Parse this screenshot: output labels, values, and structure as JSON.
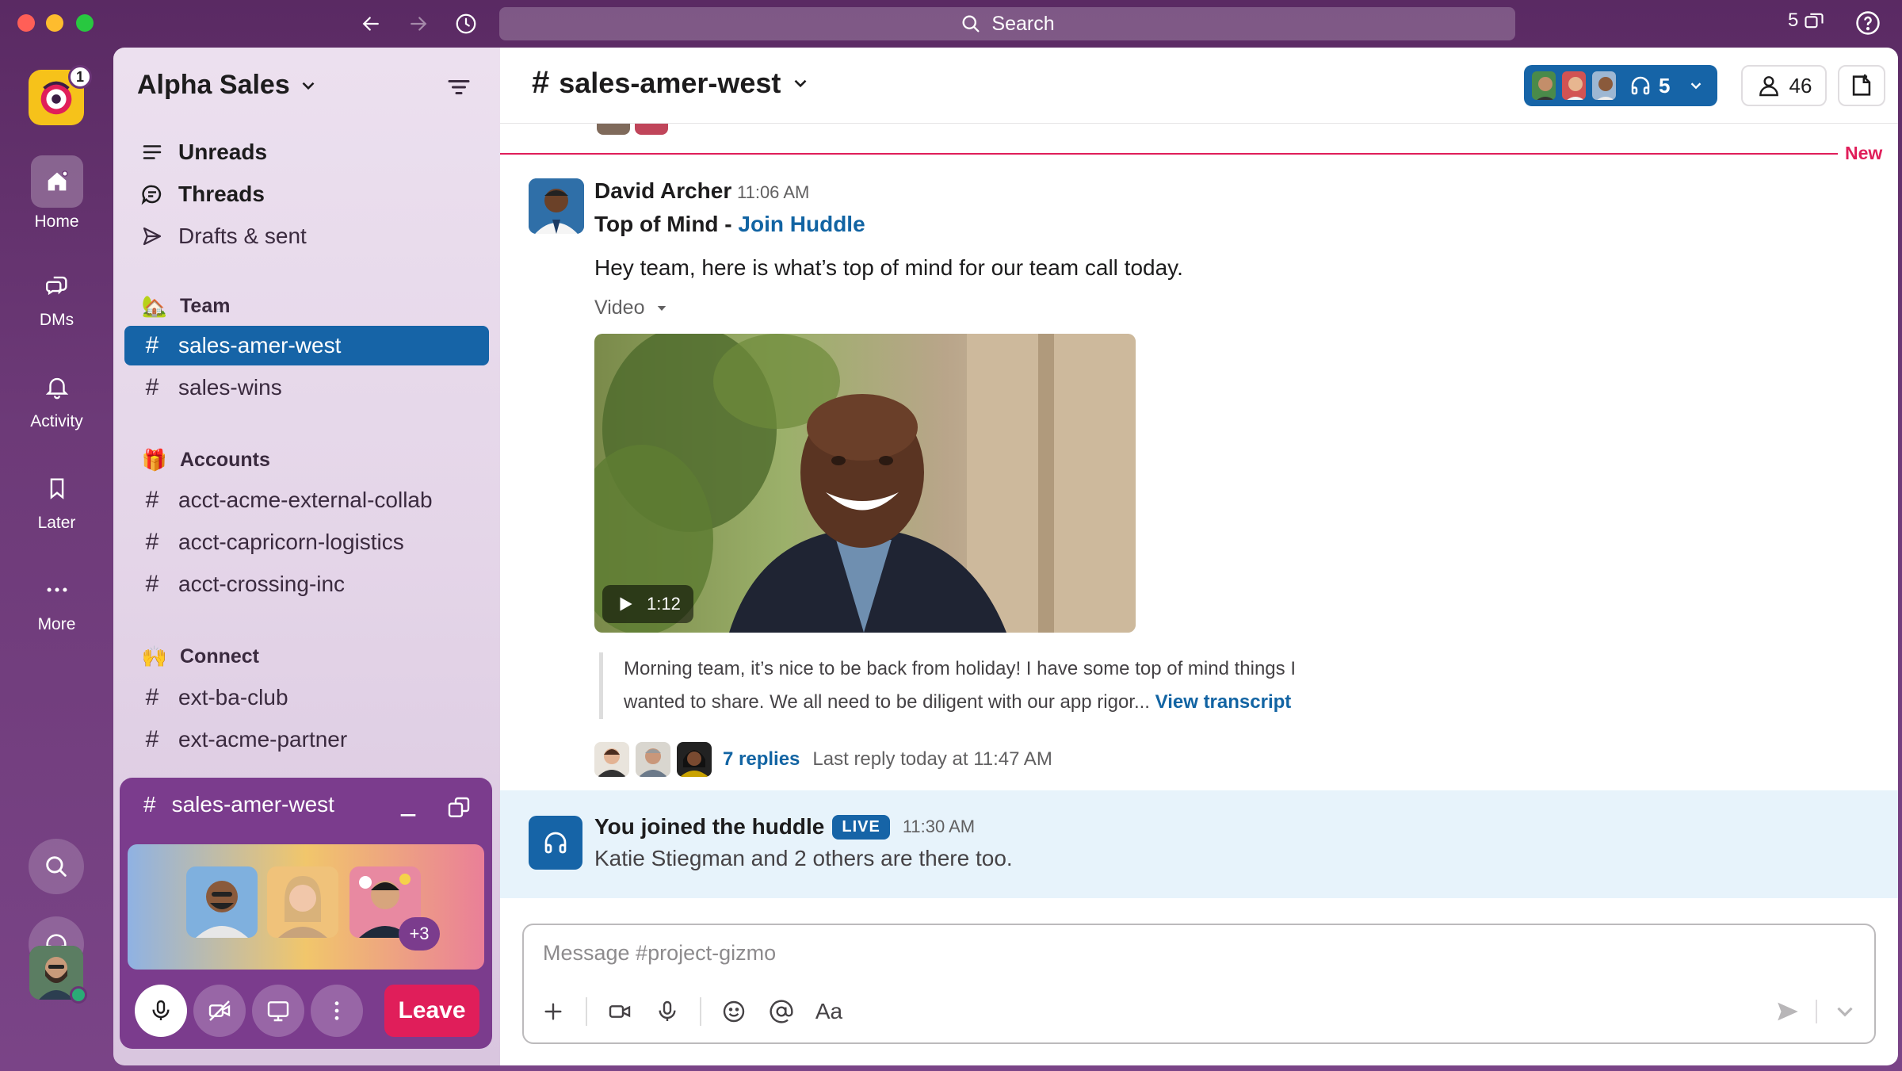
{
  "titlebar": {
    "search_placeholder": "Search",
    "windows_count": "5"
  },
  "rail": {
    "workspace_badge": "1",
    "items": [
      {
        "label": "Home"
      },
      {
        "label": "DMs"
      },
      {
        "label": "Activity"
      },
      {
        "label": "Later"
      },
      {
        "label": "More"
      }
    ]
  },
  "sidebar": {
    "workspace_name": "Alpha Sales",
    "top_items": [
      {
        "label": "Unreads"
      },
      {
        "label": "Threads"
      },
      {
        "label": "Drafts & sent"
      }
    ],
    "sections": [
      {
        "name": "Team",
        "emoji": "🏡",
        "channels": [
          "sales-amer-west",
          "sales-wins"
        ]
      },
      {
        "name": "Accounts",
        "emoji": "🎁",
        "channels": [
          "acct-acme-external-collab",
          "acct-capricorn-logistics",
          "acct-crossing-inc"
        ]
      },
      {
        "name": "Connect",
        "emoji": "🙌",
        "channels": [
          "ext-ba-club",
          "ext-acme-partner"
        ]
      }
    ],
    "active_channel": "sales-amer-west"
  },
  "huddle_panel": {
    "channel": "sales-amer-west",
    "more_count": "+3",
    "leave_label": "Leave"
  },
  "channel": {
    "name": "sales-amer-west",
    "huddle_count": "5",
    "member_count": "46"
  },
  "divider": {
    "label": "New"
  },
  "message": {
    "author": "David Archer",
    "time": "11:06 AM",
    "title_prefix": "Top of Mind - ",
    "title_link": "Join Huddle",
    "body": "Hey team, here is what’s top of mind for our team call today.",
    "attachment_label": "Video",
    "video_duration": "1:12",
    "transcript_text": "Morning team, it’s nice to be back from holiday! I have some top of mind things I wanted to share. We all need to be diligent with our app rigor... ",
    "transcript_link": "View transcript",
    "replies_count": "7 replies",
    "last_reply": "Last reply today at 11:47 AM"
  },
  "huddle_notice": {
    "title": "You joined the huddle",
    "badge": "LIVE",
    "time": "11:30 AM",
    "subtitle": "Katie Stiegman and 2 others are there too."
  },
  "composer": {
    "placeholder": "Message #project-gizmo",
    "format_label": "Aa"
  },
  "colors": {
    "aubergine": "#5a2a63",
    "active_blue": "#1664a7",
    "new_red": "#e01e5a",
    "link": "#1264a3"
  }
}
